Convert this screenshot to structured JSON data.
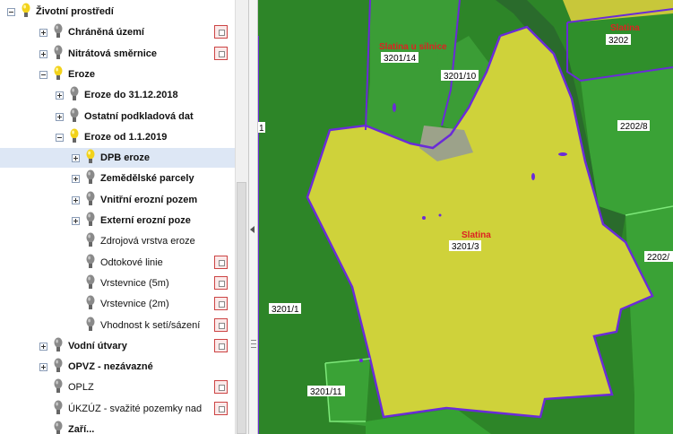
{
  "layer_tree": {
    "items": [
      {
        "label": "Životní prostředí",
        "bold": true,
        "level": 0,
        "expander": "minus",
        "bulb": "on"
      },
      {
        "label": "Chráněná území",
        "bold": true,
        "level": 1,
        "expander": "plus",
        "bulb": "off",
        "legend": true
      },
      {
        "label": "Nitrátová směrnice",
        "bold": true,
        "level": 1,
        "expander": "plus",
        "bulb": "off",
        "legend": true
      },
      {
        "label": "Eroze",
        "bold": true,
        "level": 1,
        "expander": "minus",
        "bulb": "on"
      },
      {
        "label": "Eroze do 31.12.2018",
        "bold": true,
        "level": 2,
        "expander": "plus",
        "bulb": "off"
      },
      {
        "label": "Ostatní podkladová dat",
        "bold": true,
        "level": 2,
        "expander": "plus",
        "bulb": "off"
      },
      {
        "label": "Eroze od 1.1.2019",
        "bold": true,
        "level": 2,
        "expander": "minus",
        "bulb": "on"
      },
      {
        "label": "DPB eroze",
        "bold": true,
        "level": 3,
        "expander": "plus",
        "bulb": "on",
        "selected": true
      },
      {
        "label": "Zemědělské parcely",
        "bold": true,
        "level": 3,
        "expander": "plus",
        "bulb": "off"
      },
      {
        "label": "Vnitřní erozní pozem",
        "bold": true,
        "level": 3,
        "expander": "plus",
        "bulb": "off"
      },
      {
        "label": "Externí erozní poze",
        "bold": true,
        "level": 3,
        "expander": "plus",
        "bulb": "off"
      },
      {
        "label": "Zdrojová vrstva eroze",
        "bold": false,
        "level": 3,
        "expander": "none",
        "bulb": "off"
      },
      {
        "label": "Odtokové linie",
        "bold": false,
        "level": 3,
        "expander": "none",
        "bulb": "off",
        "legend": true
      },
      {
        "label": "Vrstevnice (5m)",
        "bold": false,
        "level": 3,
        "expander": "none",
        "bulb": "off",
        "legend": true
      },
      {
        "label": "Vrstevnice (2m)",
        "bold": false,
        "level": 3,
        "expander": "none",
        "bulb": "off",
        "legend": true
      },
      {
        "label": "Vhodnost k setí/sázení",
        "bold": false,
        "level": 3,
        "expander": "none",
        "bulb": "off",
        "legend": true
      },
      {
        "label": "Vodní útvary",
        "bold": true,
        "level": 1,
        "expander": "plus",
        "bulb": "off",
        "legend": true
      },
      {
        "label": "OPVZ - nezávazné",
        "bold": true,
        "level": 1,
        "expander": "plus",
        "bulb": "off"
      },
      {
        "label": "OPLZ",
        "bold": false,
        "level": 1,
        "expander": "none",
        "bulb": "off",
        "legend": true
      },
      {
        "label": "ÚKZÚZ - svažité pozemky nad",
        "bold": false,
        "level": 1,
        "expander": "none",
        "bulb": "off",
        "legend": true
      },
      {
        "label": "Zaří...",
        "bold": true,
        "level": 1,
        "expander": "none",
        "bulb": "off"
      }
    ]
  },
  "map": {
    "parcel_labels": [
      "3201/14",
      "3201/10",
      "3202",
      "2202/8",
      "3201/3",
      "2202/",
      "3201/1",
      "3201/11",
      "1"
    ],
    "place_names": [
      "Slatina u silnice",
      "Slatina",
      "Slatina"
    ],
    "colors": {
      "dark_field": "#2f8a2a",
      "light_field": "#3ea33a",
      "yellow": "#cfd23a",
      "boundary": "#6a2bd8",
      "green_line": "#7ee87a",
      "name_red": "#d22222"
    }
  }
}
